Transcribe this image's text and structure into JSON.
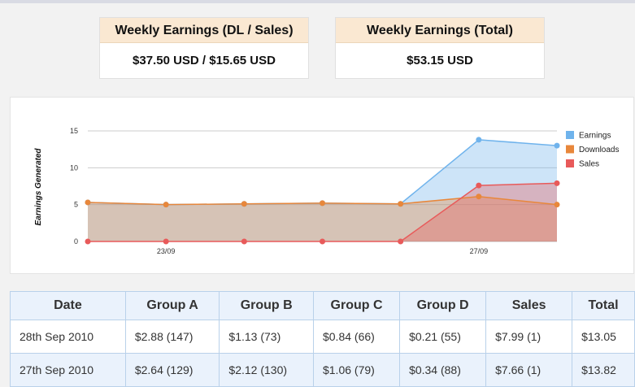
{
  "summary": {
    "dl_sales": {
      "title": "Weekly Earnings (DL / Sales)",
      "value": "$37.50 USD / $15.65 USD"
    },
    "total": {
      "title": "Weekly Earnings (Total)",
      "value": "$53.15 USD"
    }
  },
  "colors": {
    "earnings": "#6fb3ec",
    "downloads": "#e8873b",
    "sales": "#e85a5a"
  },
  "chart_data": {
    "type": "area",
    "ylabel": "Earnings Generated",
    "xlabel": "",
    "x_tick_labels": [
      {
        "index": 1,
        "label": "23/09"
      },
      {
        "index": 5,
        "label": "27/09"
      }
    ],
    "y_ticks": [
      0,
      5,
      10,
      15
    ],
    "ylim": [
      0,
      15
    ],
    "grid": true,
    "legend_position": "right",
    "point_count": 7,
    "series": [
      {
        "name": "Earnings",
        "values": [
          5.3,
          5.0,
          5.1,
          5.2,
          5.1,
          13.8,
          13.0
        ]
      },
      {
        "name": "Downloads",
        "values": [
          5.3,
          5.0,
          5.1,
          5.2,
          5.1,
          6.1,
          5.0
        ]
      },
      {
        "name": "Sales",
        "values": [
          0,
          0,
          0,
          0,
          0,
          7.6,
          7.9
        ]
      }
    ]
  },
  "table": {
    "headers": [
      "Date",
      "Group A",
      "Group B",
      "Group C",
      "Group D",
      "Sales",
      "Total"
    ],
    "rows": [
      [
        "28th Sep 2010",
        "$2.88 (147)",
        "$1.13 (73)",
        "$0.84 (66)",
        "$0.21 (55)",
        "$7.99 (1)",
        "$13.05"
      ],
      [
        "27th Sep 2010",
        "$2.64 (129)",
        "$2.12 (130)",
        "$1.06 (79)",
        "$0.34 (88)",
        "$7.66 (1)",
        "$13.82"
      ]
    ]
  }
}
